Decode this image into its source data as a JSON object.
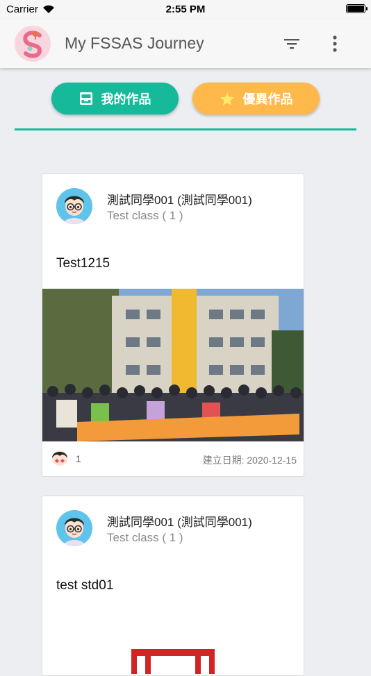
{
  "status_bar": {
    "carrier": "Carrier",
    "time": "2:55 PM"
  },
  "app_bar": {
    "title": "My FSSAS Journey",
    "icons": [
      "app-logo",
      "filter-icon",
      "more-vert-icon"
    ]
  },
  "tabs": {
    "mine_label": "我的作品",
    "excellent_label": "優異作品",
    "active": "mine",
    "colors": {
      "mine": "#16b99a",
      "excellent": "#ffb84a"
    }
  },
  "posts": [
    {
      "user_name": "測試同學001 (測試同學001)",
      "user_class": "Test class ( 1 )",
      "title": "Test1215",
      "likes": "1",
      "created": "建立日期: 2020-12-15"
    },
    {
      "user_name": "測試同學001 (測試同學001)",
      "user_class": "Test class ( 1 )",
      "title": "test std01"
    }
  ]
}
